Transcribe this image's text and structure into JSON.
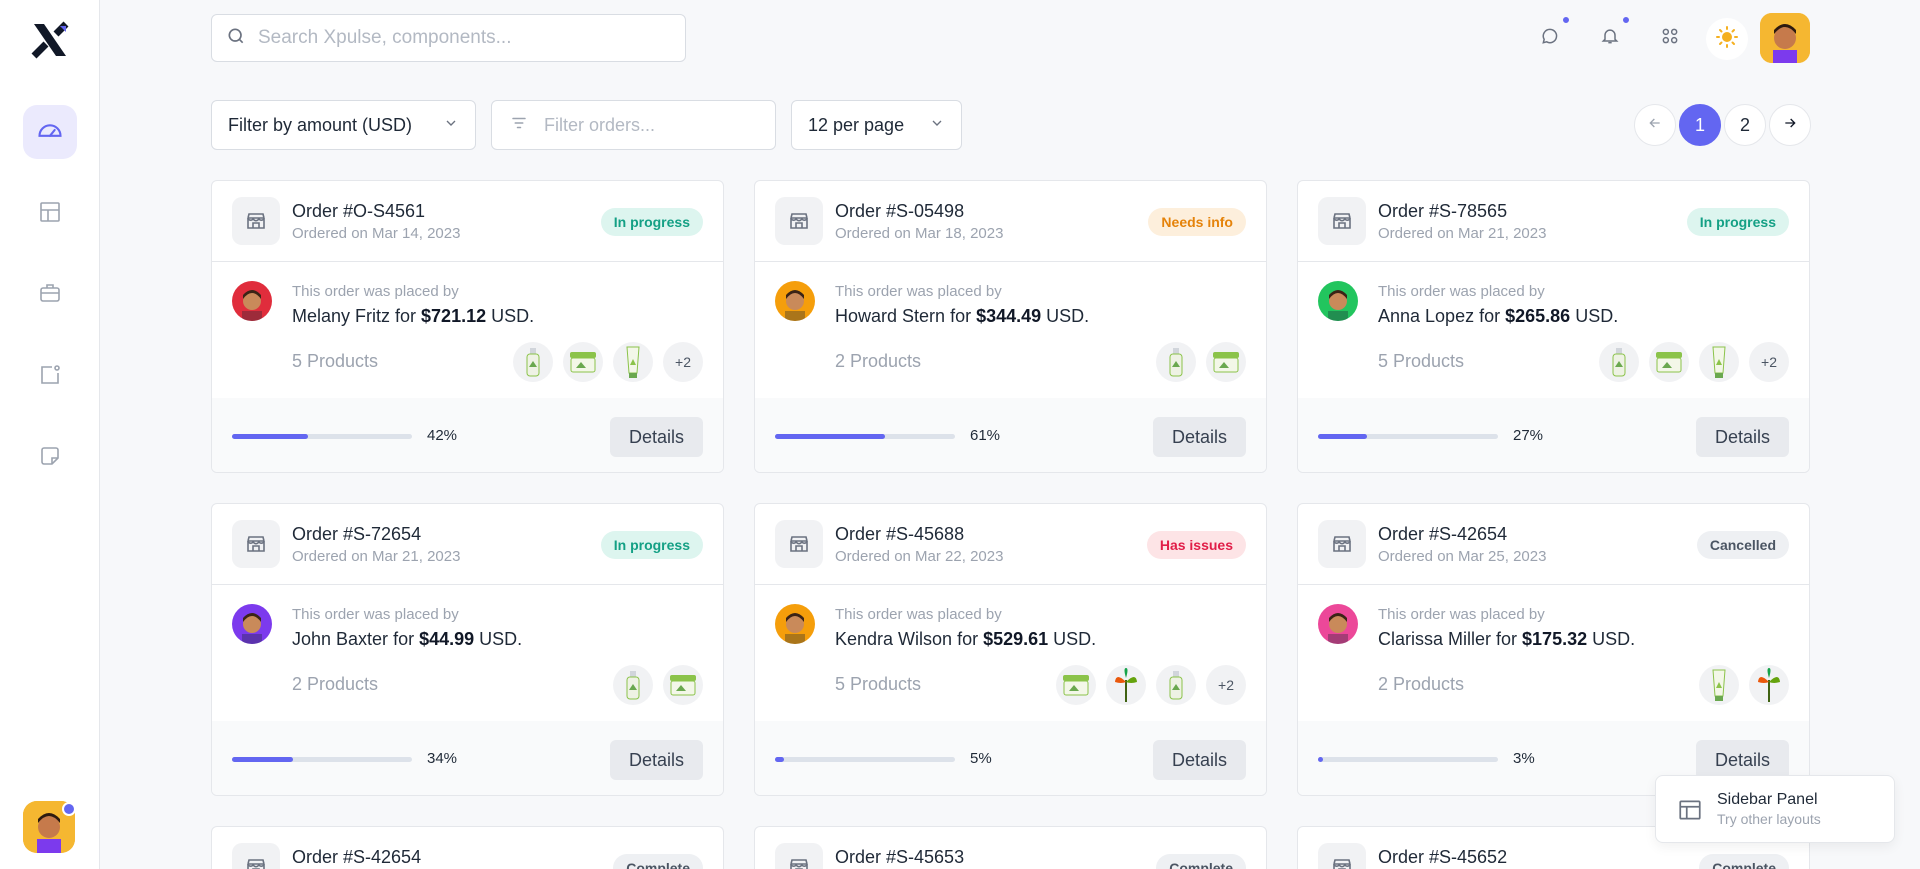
{
  "search": {
    "placeholder": "Search Xpulse, components..."
  },
  "toolbar": {
    "amount_filter": "Filter by amount (USD)",
    "orders_filter_placeholder": "Filter orders...",
    "per_page": "12 per page"
  },
  "pagination": {
    "pages": [
      "1",
      "2"
    ],
    "current": "1"
  },
  "orders": [
    {
      "id": "Order #O-S4561",
      "date": "Ordered on Mar 14, 2023",
      "status": "In progress",
      "status_type": "progress",
      "placed_label": "This order was placed by",
      "customer": "Melany Fritz",
      "for_word": " for ",
      "amount": "$721.12",
      "currency": " USD.",
      "products": "5 Products",
      "thumbs": [
        "bottle",
        "jar",
        "tube",
        "+2"
      ],
      "progress": 42,
      "progress_label": "42%",
      "details": "Details",
      "avatar_color": "#e02d3c"
    },
    {
      "id": "Order #S-05498",
      "date": "Ordered on Mar 18, 2023",
      "status": "Needs info",
      "status_type": "info",
      "placed_label": "This order was placed by",
      "customer": "Howard Stern",
      "for_word": " for ",
      "amount": "$344.49",
      "currency": " USD.",
      "products": "2 Products",
      "thumbs": [
        "bottle",
        "jar"
      ],
      "progress": 61,
      "progress_label": "61%",
      "details": "Details",
      "avatar_color": "#f59e0b"
    },
    {
      "id": "Order #S-78565",
      "date": "Ordered on Mar 21, 2023",
      "status": "In progress",
      "status_type": "progress",
      "placed_label": "This order was placed by",
      "customer": "Anna Lopez",
      "for_word": " for ",
      "amount": "$265.86",
      "currency": " USD.",
      "products": "5 Products",
      "thumbs": [
        "bottle",
        "jar",
        "tube",
        "+2"
      ],
      "progress": 27,
      "progress_label": "27%",
      "details": "Details",
      "avatar_color": "#22c55e"
    },
    {
      "id": "Order #S-72654",
      "date": "Ordered on Mar 21, 2023",
      "status": "In progress",
      "status_type": "progress",
      "placed_label": "This order was placed by",
      "customer": "John Baxter",
      "for_word": " for ",
      "amount": "$44.99",
      "currency": " USD.",
      "products": "2 Products",
      "thumbs": [
        "bottle",
        "jar"
      ],
      "progress": 34,
      "progress_label": "34%",
      "details": "Details",
      "avatar_color": "#7c3aed"
    },
    {
      "id": "Order #S-45688",
      "date": "Ordered on Mar 22, 2023",
      "status": "Has issues",
      "status_type": "issues",
      "placed_label": "This order was placed by",
      "customer": "Kendra Wilson",
      "for_word": " for ",
      "amount": "$529.61",
      "currency": " USD.",
      "products": "5 Products",
      "thumbs": [
        "jar",
        "plant",
        "bottle",
        "+2"
      ],
      "progress": 5,
      "progress_label": "5%",
      "details": "Details",
      "avatar_color": "#f59e0b"
    },
    {
      "id": "Order #S-42654",
      "date": "Ordered on Mar 25, 2023",
      "status": "Cancelled",
      "status_type": "cancel",
      "placed_label": "This order was placed by",
      "customer": "Clarissa Miller",
      "for_word": " for ",
      "amount": "$175.32",
      "currency": " USD.",
      "products": "2 Products",
      "thumbs": [
        "tube",
        "plant"
      ],
      "progress": 3,
      "progress_label": "3%",
      "details": "Details",
      "avatar_color": "#ec4899"
    }
  ],
  "partial_orders": [
    {
      "id": "Order #S-42654",
      "status": "Complete"
    },
    {
      "id": "Order #S-45653",
      "status": "Complete"
    },
    {
      "id": "Order #S-45652",
      "status": "Complete"
    }
  ],
  "layout_panel": {
    "title": "Sidebar Panel",
    "subtitle": "Try other layouts"
  },
  "colors": {
    "accent": "#6366f1",
    "in_progress": "#14a085",
    "needs_info": "#e5830a",
    "has_issues": "#e11d48",
    "cancelled": "#4b5563"
  }
}
